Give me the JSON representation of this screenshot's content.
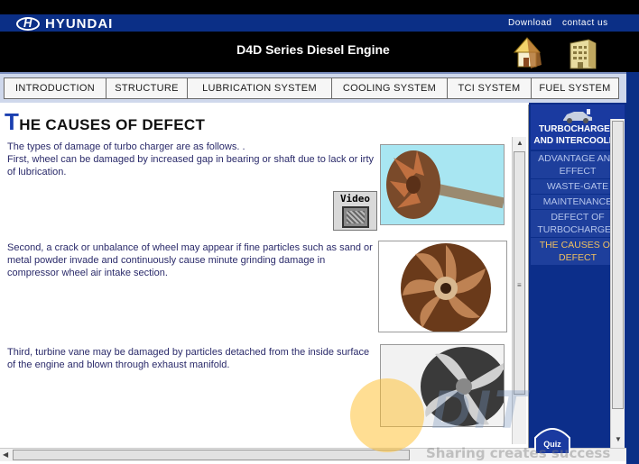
{
  "header": {
    "brand": "HYUNDAI",
    "download_link": "Download",
    "contact_link": "contact us",
    "title": "D4D Series Diesel Engine"
  },
  "nav": {
    "tabs": [
      {
        "label": "INTRODUCTION"
      },
      {
        "label": "STRUCTURE"
      },
      {
        "label": "LUBRICATION SYSTEM"
      },
      {
        "label": "COOLING SYSTEM"
      },
      {
        "label": "TCI SYSTEM"
      },
      {
        "label": "FUEL SYSTEM"
      }
    ]
  },
  "content": {
    "title_first_letter": "T",
    "title_rest": "HE CAUSES OF DEFECT",
    "paragraph_1": "The types of damage of turbo charger are as follows. .\nFirst, wheel can be damaged by increased gap in bearing or shaft due to lack or irty of lubrication.",
    "paragraph_2": "Second, a crack or unbalance of wheel may appear if fine particles such as sand or metal powder invade and continuously cause minute grinding damage in compressor wheel air intake section.",
    "paragraph_3": "Third, turbine vane may be damaged by particles detached from the inside surface of the engine and blown through exhaust manifold.",
    "video_label": "Video"
  },
  "sidebar": {
    "heading": "TURBOCHARGER AND INTERCOOLER",
    "items": [
      {
        "label": "ADVANTAGE AND EFFECT",
        "active": false
      },
      {
        "label": "WASTE-GATE",
        "active": false
      },
      {
        "label": "MAINTENANCE",
        "active": false
      },
      {
        "label": "DEFECT OF TURBOCHARGER",
        "active": false
      },
      {
        "label": "THE CAUSES OF DEFECT",
        "active": true
      }
    ]
  },
  "quiz": {
    "label": "Quiz"
  },
  "watermark": {
    "text": "DIT",
    "slogan": "Sharing creates success"
  },
  "colors": {
    "brand_blue": "#0b2f86",
    "title_blue": "#1a3fb0",
    "active_menu": "#f0c060",
    "body_text": "#2a2a6a"
  }
}
